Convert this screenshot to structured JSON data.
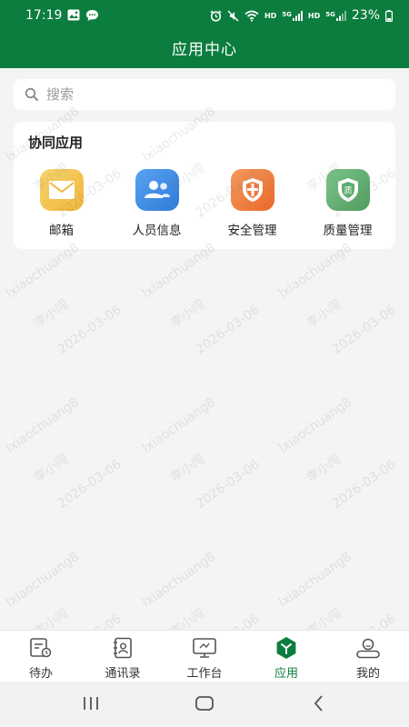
{
  "status_bar": {
    "time": "17:19",
    "right_tags": [
      "HD",
      "5G",
      "HD",
      "5G"
    ],
    "battery": "23%"
  },
  "header": {
    "title": "应用中心"
  },
  "search": {
    "placeholder": "搜索"
  },
  "section": {
    "title": "协同应用",
    "apps": [
      {
        "label": "邮箱",
        "icon": "mail-icon",
        "color": "#f2c24e"
      },
      {
        "label": "人员信息",
        "icon": "people-icon",
        "color": "#3f8ee6"
      },
      {
        "label": "安全管理",
        "icon": "shield-cross-icon",
        "color": "#ee7a3f"
      },
      {
        "label": "质量管理",
        "icon": "quality-shield-icon",
        "color": "#5fae6e"
      }
    ]
  },
  "watermark": {
    "user": "李小闯",
    "account": "lxiaochuang8",
    "date": "2026-03-06"
  },
  "bottom_nav": {
    "items": [
      {
        "label": "待办",
        "icon": "todo-icon"
      },
      {
        "label": "通讯录",
        "icon": "contacts-icon"
      },
      {
        "label": "工作台",
        "icon": "workbench-icon"
      },
      {
        "label": "应用",
        "icon": "apps-icon"
      },
      {
        "label": "我的",
        "icon": "profile-icon"
      }
    ],
    "active_index": 3
  },
  "colors": {
    "brand": "#0b7d3e",
    "background": "#f4f4f4"
  }
}
